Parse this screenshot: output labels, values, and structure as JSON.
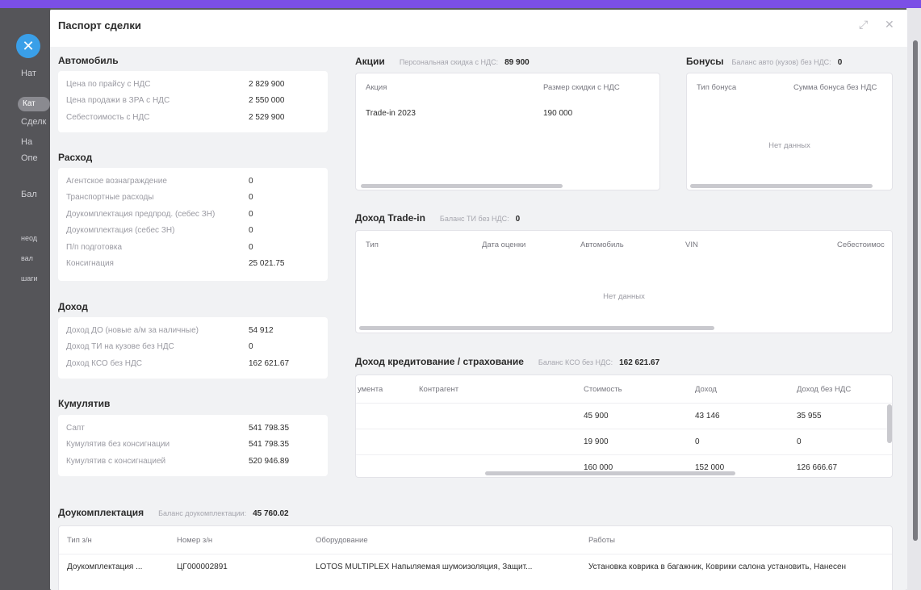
{
  "background": {
    "sidebar_items": [
      "Нат",
      "Сде",
      "Сделк",
      "На",
      "Опе",
      "Бал",
      "неод",
      "вал",
      "шаги"
    ],
    "sidebar_pill": "Кат",
    "fab_icon": "close-icon"
  },
  "modal": {
    "title": "Паспорт сделки",
    "expand_icon": "expand-icon",
    "close_icon": "close-icon"
  },
  "car": {
    "title": "Автомобиль",
    "rows": [
      {
        "key": "Цена по прайсу с НДС",
        "value": "2 829 900"
      },
      {
        "key": "Цена продажи в ЗРА с НДС",
        "value": "2 550 000"
      },
      {
        "key": "Себестоимость с НДС",
        "value": "2 529 900"
      }
    ]
  },
  "expense": {
    "title": "Расход",
    "rows": [
      {
        "key": "Агентское вознаграждение",
        "value": "0"
      },
      {
        "key": "Транспортные расходы",
        "value": "0"
      },
      {
        "key": "Доукомплектация предпрод. (себес ЗН)",
        "value": "0"
      },
      {
        "key": "Доукомплектация (себес ЗН)",
        "value": "0"
      },
      {
        "key": "П/п подготовка",
        "value": "0"
      },
      {
        "key": "Консигнация",
        "value": "25 021.75"
      }
    ]
  },
  "income": {
    "title": "Доход",
    "rows": [
      {
        "key": "Доход ДО (новые а/м за наличные)",
        "value": "54 912"
      },
      {
        "key": "Доход ТИ на кузове без НДС",
        "value": "0"
      },
      {
        "key": "Доход КСО без НДС",
        "value": "162 621.67"
      }
    ]
  },
  "cumulative": {
    "title": "Кумулятив",
    "rows": [
      {
        "key": "Сапт",
        "value": "541 798.35"
      },
      {
        "key": "Кумулятив без консигнации",
        "value": "541 798.35"
      },
      {
        "key": "Кумулятив с консигнацией",
        "value": "520 946.89"
      }
    ]
  },
  "promos": {
    "title": "Акции",
    "balance_label": "Персональная скидка с НДС:",
    "balance_value": "89 900",
    "columns": [
      "Акция",
      "Размер скидки с НДС"
    ],
    "rows": [
      {
        "name": "Trade-in 2023",
        "amount": "190 000"
      }
    ]
  },
  "bonuses": {
    "title": "Бонусы",
    "balance_label": "Баланс авто (кузов) без НДС:",
    "balance_value": "0",
    "columns": [
      "Тип бонуса",
      "Сумма бонуса без НДС"
    ],
    "empty": "Нет данных"
  },
  "tradein": {
    "title": "Доход Trade-in",
    "balance_label": "Баланс ТИ без НДС:",
    "balance_value": "0",
    "columns": [
      "Тип",
      "Дата оценки",
      "Автомобиль",
      "VIN",
      "Себестоимос"
    ],
    "empty": "Нет данных"
  },
  "credit": {
    "title": "Доход кредитование / страхование",
    "balance_label": "Баланс КСО без НДС:",
    "balance_value": "162 621.67",
    "columns": [
      "умента",
      "Контрагент",
      "Стоимость",
      "Доход",
      "Доход без НДС"
    ],
    "rows": [
      {
        "cost": "45 900",
        "income": "43 146",
        "net": "35 955"
      },
      {
        "cost": "19 900",
        "income": "0",
        "net": "0"
      },
      {
        "cost": "160 000",
        "income": "152 000",
        "net": "126 666.67"
      }
    ]
  },
  "extra": {
    "title": "Доукомплектация",
    "balance_label": "Баланс доукомплектации:",
    "balance_value": "45 760.02",
    "columns": [
      "Тип з/н",
      "Номер з/н",
      "Оборудование",
      "Работы"
    ],
    "rows": [
      {
        "type": "Доукомплектация ...",
        "number": "ЦГ000002891",
        "equipment": "LOTOS MULTIPLEX Напыляемая шумоизоляция, Защит...",
        "works": "Установка коврика в багажник, Коврики салона установить, Нанесен"
      }
    ]
  }
}
